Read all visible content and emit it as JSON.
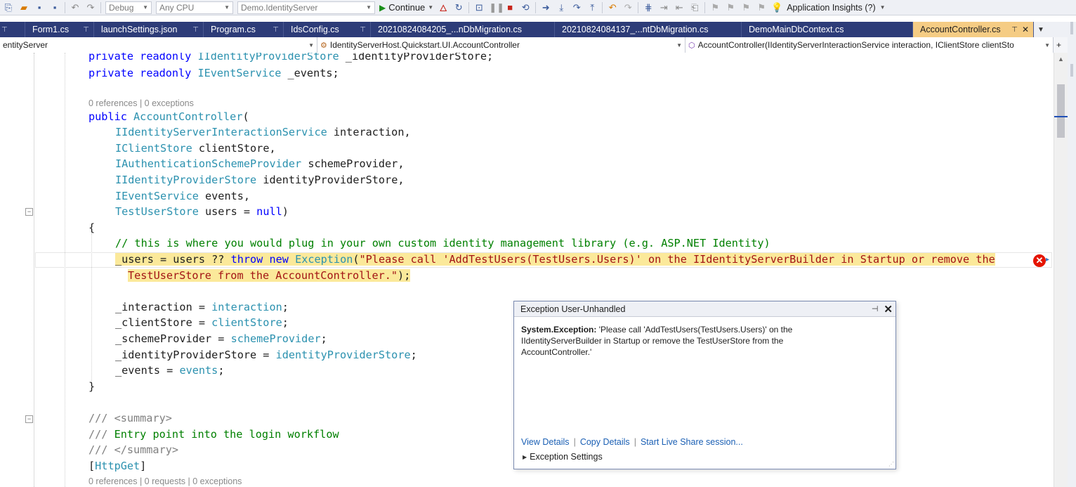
{
  "toolbar": {
    "config": "Debug",
    "platform": "Any CPU",
    "startup_project": "Demo.IdentityServer",
    "continue_label": "Continue",
    "insights_label": "Application Insights (?)"
  },
  "tabs": [
    {
      "label": "Form1.cs",
      "active": false
    },
    {
      "label": "launchSettings.json",
      "active": false
    },
    {
      "label": "Program.cs",
      "active": false
    },
    {
      "label": "IdsConfig.cs",
      "active": false
    },
    {
      "label": "20210824084205_...nDbMigration.cs",
      "active": false
    },
    {
      "label": "20210824084137_...ntDbMigration.cs",
      "active": false
    },
    {
      "label": "DemoMainDbContext.cs",
      "active": false
    },
    {
      "label": "AccountController.cs",
      "active": true
    }
  ],
  "navbar": {
    "project": "entityServer",
    "type": "IdentityServerHost.Quickstart.UI.AccountController",
    "member": "AccountController(IIdentityServerInteractionService interaction, IClientStore clientSto"
  },
  "code": {
    "field1": [
      "private",
      " ",
      "readonly",
      " ",
      "IIdentityProviderStore",
      " _identityProviderStore;"
    ],
    "field2": [
      "private",
      " ",
      "readonly",
      " ",
      "IEventService",
      " _events;"
    ],
    "lens1": "0 references | 0 exceptions",
    "ctor_public": "public",
    "ctor_name": "AccountController",
    "ctor_paren": "(",
    "p1_type": "IIdentityServerInteractionService",
    "p1_name": " interaction,",
    "p2_type": "IClientStore",
    "p2_name": " clientStore,",
    "p3_type": "IAuthenticationSchemeProvider",
    "p3_name": " schemeProvider,",
    "p4_type": "IIdentityProviderStore",
    "p4_name": " identityProviderStore,",
    "p5_type": "IEventService",
    "p5_name": " events,",
    "p6_type": "TestUserStore",
    "p6_name": " users = ",
    "p6_null": "null",
    "p6_end": ")",
    "open_brace": "{",
    "comment": "// this is where you would plug in your own custom identity management library (e.g. ASP.NET Identity)",
    "throw_a": "_users = users ?? ",
    "throw_kw": "throw",
    "throw_b": " ",
    "throw_new": "new",
    "throw_c": " ",
    "throw_type": "Exception",
    "throw_d": "(",
    "throw_str1": "\"Please call 'AddTestUsers(TestUsers.Users)' on the IIdentityServerBuilder in Startup or remove the",
    "throw_str2": "TestUserStore from the AccountController.\"",
    "throw_end": ");",
    "a1": "_interaction = ",
    "a1v": "interaction",
    "a1e": ";",
    "a2": "_clientStore = ",
    "a2v": "clientStore",
    "a2e": ";",
    "a3": "_schemeProvider = ",
    "a3v": "schemeProvider",
    "a3e": ";",
    "a4": "_identityProviderStore = ",
    "a4v": "identityProviderStore",
    "a4e": ";",
    "a5": "_events = ",
    "a5v": "events",
    "a5e": ";",
    "close_brace": "}",
    "doc1": "/// <summary>",
    "doc2_prefix": "/// ",
    "doc2": "Entry point into the login workflow",
    "doc3": "/// </summary>",
    "attr_open": "[",
    "attr": "HttpGet",
    "attr_close": "]",
    "lens2": "0 references | 0 requests | 0 exceptions"
  },
  "exception": {
    "title": "Exception User-Unhandled",
    "type": "System.Exception:",
    "message": " 'Please call 'AddTestUsers(TestUsers.Users)' on the IIdentityServerBuilder in Startup or remove the TestUserStore from the AccountController.'",
    "link_details": "View Details",
    "link_copy": "Copy Details",
    "link_share": "Start Live Share session...",
    "settings": "Exception Settings"
  }
}
